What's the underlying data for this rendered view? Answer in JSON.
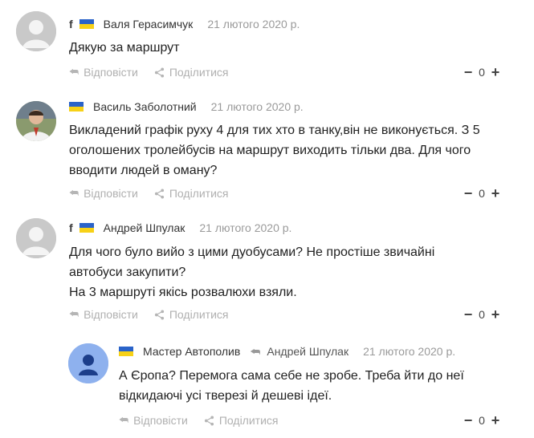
{
  "comments": [
    {
      "author": "Валя Герасимчук",
      "fb": "f",
      "date": "21 лютого 2020 р.",
      "text_lines": [
        "Дякую за маршрут"
      ],
      "reply_label": "Відповісти",
      "share_label": "Поділитися",
      "score": "0"
    },
    {
      "author": "Василь Заболотний",
      "date": "21 лютого 2020 р.",
      "text_lines": [
        "Викладений графік руху 4 для тих хто в танку,він не виконується. З 5",
        "оголошених тролейбусів на маршрут виходить тільки два. Для чого",
        "вводити людей в оману?"
      ],
      "reply_label": "Відповісти",
      "share_label": "Поділитися",
      "score": "0"
    },
    {
      "author": "Андрей Шпулак",
      "fb": "f",
      "date": "21 лютого 2020 р.",
      "text_lines": [
        "Для чого було вийо з цими дуобусами? Не простіше звичайні",
        "автобуси закупити?",
        "На 3 маршруті якісь розвалюхи взяли."
      ],
      "reply_label": "Відповісти",
      "share_label": "Поділитися",
      "score": "0"
    },
    {
      "author": "Мастер Автополив",
      "reply_to": "Андрей Шпулак",
      "date": "21 лютого 2020 р.",
      "text_lines": [
        "А Єропа? Перемога сама себе не зробе. Треба йти до неї",
        "відкидаючі усі тверезі й дешеві ідеї."
      ],
      "reply_label": "Відповісти",
      "share_label": "Поділитися",
      "score": "0"
    }
  ],
  "colors": {
    "flag_blue": "#2a63c9",
    "flag_yellow": "#f7d117",
    "muted": "#b0b0b0",
    "date": "#9a9a9a"
  },
  "icons": {
    "reply": "reply-arrow-icon",
    "share": "share-icon",
    "vote_down": "minus-icon",
    "vote_up": "plus-icon"
  }
}
